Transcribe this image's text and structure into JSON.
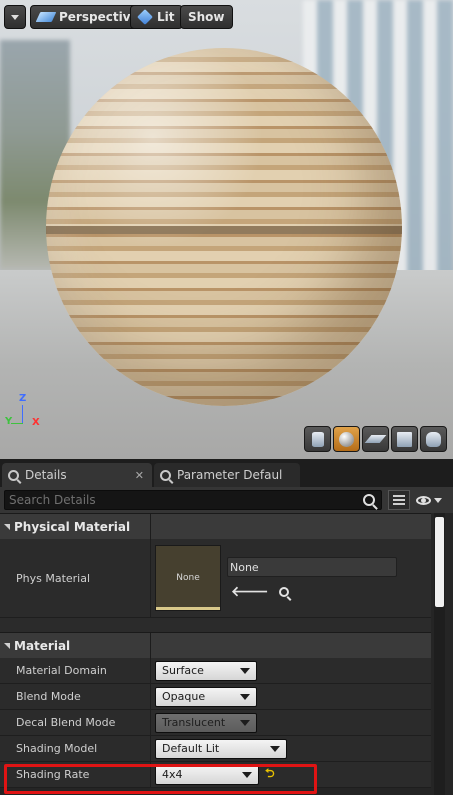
{
  "viewport": {
    "perspective_label": "Perspective",
    "lit_label": "Lit",
    "show_label": "Show",
    "axes": {
      "x": "X",
      "y": "Y",
      "z": "Z"
    }
  },
  "tabs": [
    {
      "label": "Details"
    },
    {
      "label": "Parameter Defaults"
    }
  ],
  "search": {
    "placeholder": "Search Details"
  },
  "sections": {
    "physical_material": "Physical Material",
    "material": "Material"
  },
  "phys_material": {
    "label": "Phys Material",
    "thumb_text": "None",
    "value": "None"
  },
  "properties": [
    {
      "label": "Material Domain",
      "value": "Surface"
    },
    {
      "label": "Blend Mode",
      "value": "Opaque"
    },
    {
      "label": "Decal Blend Mode",
      "value": "Translucent"
    },
    {
      "label": "Shading Model",
      "value": "Default Lit"
    },
    {
      "label": "Shading Rate",
      "value": "4x4"
    }
  ],
  "colors": {
    "accent": "#e0a24a",
    "highlight": "#e01414",
    "reset": "#e8c100"
  }
}
